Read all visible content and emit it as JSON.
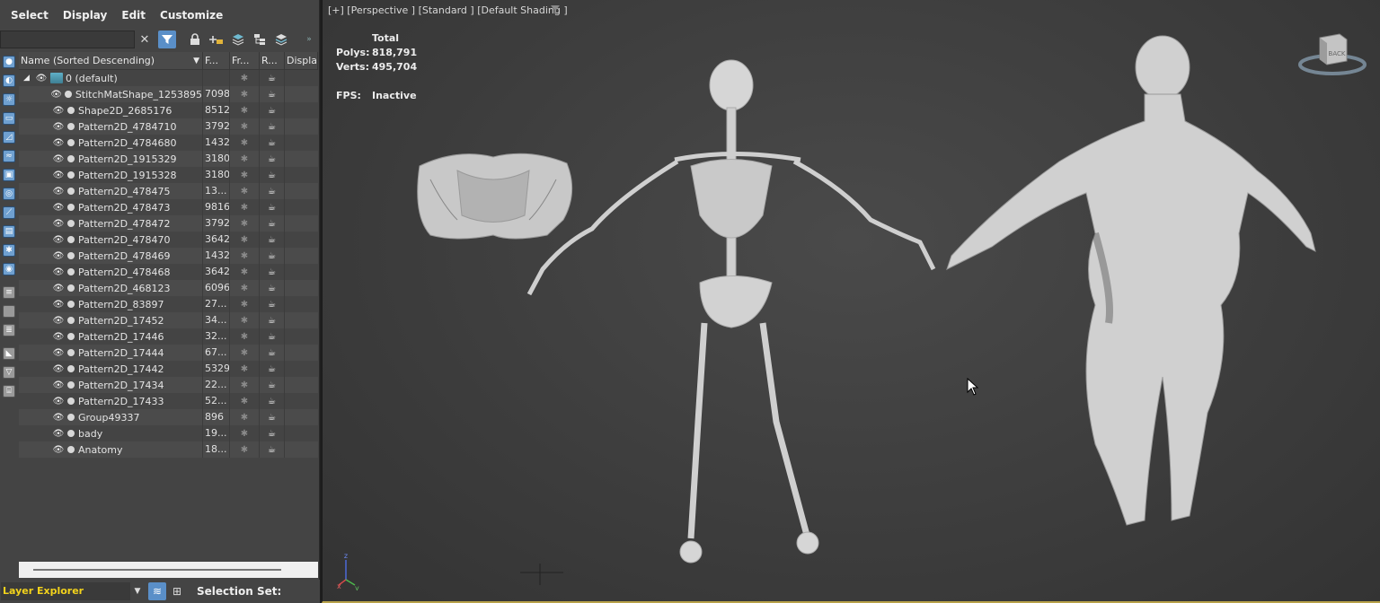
{
  "menubar": {
    "items": [
      "Select",
      "Display",
      "Edit",
      "Customize"
    ]
  },
  "toolbar": {
    "search_value": "",
    "icons": [
      "clear-search-icon",
      "filter-icon",
      "lock-icon",
      "new-layer-icon",
      "layers-icon",
      "hierarchy-icon",
      "layer-stack-icon"
    ]
  },
  "table": {
    "headers": {
      "name": "Name (Sorted Descending)",
      "faces": "F...",
      "frozen": "Fr...",
      "render": "R...",
      "display": "Display"
    },
    "layer": {
      "name": "0 (default)"
    },
    "rows": [
      {
        "name": "StitchMatShape_1253895",
        "faces": "7098"
      },
      {
        "name": "Shape2D_2685176",
        "faces": "8512"
      },
      {
        "name": "Pattern2D_4784710",
        "faces": "3792"
      },
      {
        "name": "Pattern2D_4784680",
        "faces": "1432"
      },
      {
        "name": "Pattern2D_1915329",
        "faces": "3180"
      },
      {
        "name": "Pattern2D_1915328",
        "faces": "3180"
      },
      {
        "name": "Pattern2D_478475",
        "faces": "13..."
      },
      {
        "name": "Pattern2D_478473",
        "faces": "9816"
      },
      {
        "name": "Pattern2D_478472",
        "faces": "3792"
      },
      {
        "name": "Pattern2D_478470",
        "faces": "3642"
      },
      {
        "name": "Pattern2D_478469",
        "faces": "1432"
      },
      {
        "name": "Pattern2D_478468",
        "faces": "3642"
      },
      {
        "name": "Pattern2D_468123",
        "faces": "6096"
      },
      {
        "name": "Pattern2D_83897",
        "faces": "27..."
      },
      {
        "name": "Pattern2D_17452",
        "faces": "34..."
      },
      {
        "name": "Pattern2D_17446",
        "faces": "32..."
      },
      {
        "name": "Pattern2D_17444",
        "faces": "67..."
      },
      {
        "name": "Pattern2D_17442",
        "faces": "5329"
      },
      {
        "name": "Pattern2D_17434",
        "faces": "22..."
      },
      {
        "name": "Pattern2D_17433",
        "faces": "52..."
      },
      {
        "name": "Group49337",
        "faces": "896"
      },
      {
        "name": "bady",
        "faces": "19..."
      },
      {
        "name": "Anatomy",
        "faces": "18..."
      }
    ]
  },
  "bottombar": {
    "explorer_name": "Layer Explorer",
    "selection_set_label": "Selection Set:"
  },
  "viewport": {
    "label": "[+] [Perspective ] [Standard ] [Default Shading ]",
    "stats": {
      "total_label": "Total",
      "polys_label": "Polys:",
      "polys_value": "818,791",
      "verts_label": "Verts:",
      "verts_value": "495,704",
      "fps_label": "FPS:",
      "fps_value": "Inactive"
    },
    "viewcube_face": "BACK",
    "axes": {
      "x": "x",
      "y": "y",
      "z": "z"
    }
  },
  "colors": {
    "accent": "#5a8fc8",
    "layer_name": "#f2d21c",
    "viewport_border": "#b8a24a"
  }
}
